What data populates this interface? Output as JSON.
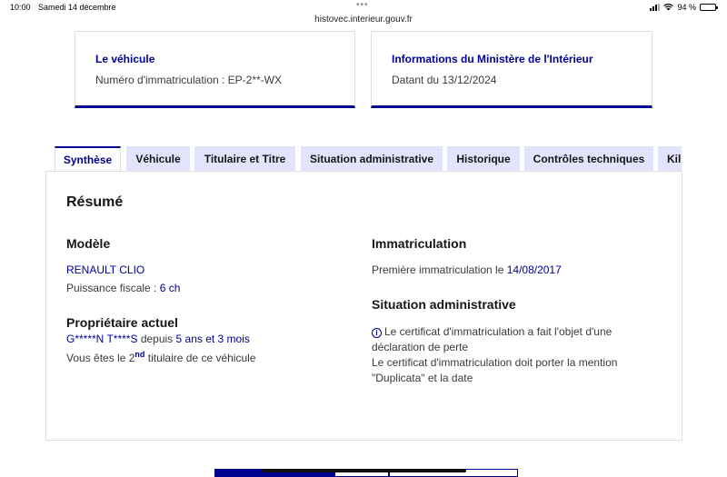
{
  "status_bar": {
    "time": "10:00",
    "date": "Samedi 14 décembre",
    "url": "histovec.interieur.gouv.fr",
    "battery": "94 %"
  },
  "cards": {
    "vehicle": {
      "title": "Le véhicule",
      "text": "Numéro d'immatriculation : EP-2**-WX"
    },
    "ministry": {
      "title": "Informations du Ministère de l'Intérieur",
      "text": "Datant du 13/12/2024"
    }
  },
  "tabs": [
    {
      "label": "Synthèse",
      "active": true
    },
    {
      "label": "Véhicule",
      "active": false
    },
    {
      "label": "Titulaire et Titre",
      "active": false
    },
    {
      "label": "Situation administrative",
      "active": false
    },
    {
      "label": "Historique",
      "active": false
    },
    {
      "label": "Contrôles techniques",
      "active": false
    },
    {
      "label": "Kil",
      "active": false
    }
  ],
  "summary": {
    "title": "Résumé",
    "model": {
      "heading": "Modèle",
      "name": "RENAULT CLIO",
      "power_label": "Puissance fiscale : ",
      "power_value": "6 ch"
    },
    "owner": {
      "heading": "Propriétaire actuel",
      "name": "G*****N T****S",
      "since_label": " depuis ",
      "since_value": "5 ans et 3 mois",
      "rank_prefix": "Vous êtes le ",
      "rank_number": "2",
      "rank_suffix": "nd",
      "rank_rest": " titulaire de ce véhicule"
    },
    "registration": {
      "heading": "Immatriculation",
      "first_label": "Première immatriculation le ",
      "first_date": "14/08/2017"
    },
    "admin": {
      "heading": "Situation administrative",
      "line1": "Le certificat d'immatriculation a fait l'objet d'une",
      "line2": "déclaration de perte",
      "line3": "Le certificat d'immatriculation doit porter la mention",
      "line4": "\"Duplicata\" et la date"
    }
  },
  "colors": {
    "accent": "#000091",
    "tab_bg": "#e3e3fd"
  }
}
